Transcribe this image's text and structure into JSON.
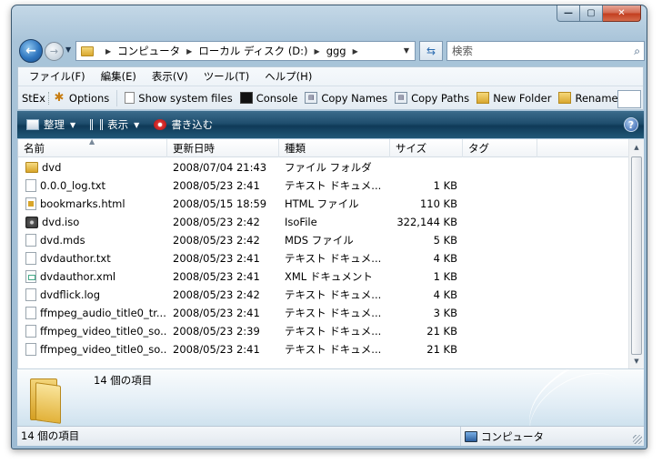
{
  "address": {
    "crumbs": [
      "コンピュータ",
      "ローカル ディスク (D:)",
      "ggg"
    ]
  },
  "search": {
    "placeholder": "検索"
  },
  "menubar": {
    "items": [
      "ファイル(F)",
      "編集(E)",
      "表示(V)",
      "ツール(T)",
      "ヘルプ(H)"
    ]
  },
  "stex": {
    "label": "StEx",
    "buttons": [
      "Options",
      "Show system files",
      "Console",
      "Copy Names",
      "Copy Paths",
      "New Folder",
      "Rename"
    ]
  },
  "commandbar": {
    "organize": "整理",
    "view": "表示",
    "burn": "書き込む"
  },
  "columns": {
    "name": "名前",
    "date": "更新日時",
    "type": "種類",
    "size": "サイズ",
    "tag": "タグ"
  },
  "files": [
    {
      "name": "dvd",
      "date": "2008/07/04 21:43",
      "type": "ファイル フォルダ",
      "size": "",
      "icon": "folder"
    },
    {
      "name": "0.0.0_log.txt",
      "date": "2008/05/23 2:41",
      "type": "テキスト ドキュメ...",
      "size": "1 KB",
      "icon": "doc"
    },
    {
      "name": "bookmarks.html",
      "date": "2008/05/15 18:59",
      "type": "HTML ファイル",
      "size": "110 KB",
      "icon": "html"
    },
    {
      "name": "dvd.iso",
      "date": "2008/05/23 2:42",
      "type": "IsoFile",
      "size": "322,144 KB",
      "icon": "iso"
    },
    {
      "name": "dvd.mds",
      "date": "2008/05/23 2:42",
      "type": "MDS ファイル",
      "size": "5 KB",
      "icon": "doc"
    },
    {
      "name": "dvdauthor.txt",
      "date": "2008/05/23 2:41",
      "type": "テキスト ドキュメ...",
      "size": "4 KB",
      "icon": "doc"
    },
    {
      "name": "dvdauthor.xml",
      "date": "2008/05/23 2:41",
      "type": "XML ドキュメント",
      "size": "1 KB",
      "icon": "xml"
    },
    {
      "name": "dvdflick.log",
      "date": "2008/05/23 2:42",
      "type": "テキスト ドキュメ...",
      "size": "4 KB",
      "icon": "doc"
    },
    {
      "name": "ffmpeg_audio_title0_tr...",
      "date": "2008/05/23 2:41",
      "type": "テキスト ドキュメ...",
      "size": "3 KB",
      "icon": "doc"
    },
    {
      "name": "ffmpeg_video_title0_so...",
      "date": "2008/05/23 2:39",
      "type": "テキスト ドキュメ...",
      "size": "21 KB",
      "icon": "doc"
    },
    {
      "name": "ffmpeg_video_title0_so...",
      "date": "2008/05/23 2:41",
      "type": "テキスト ドキュメ...",
      "size": "21 KB",
      "icon": "doc"
    }
  ],
  "details": {
    "count": "14 個の項目"
  },
  "status": {
    "count": "14 個の項目",
    "location": "コンピュータ"
  }
}
